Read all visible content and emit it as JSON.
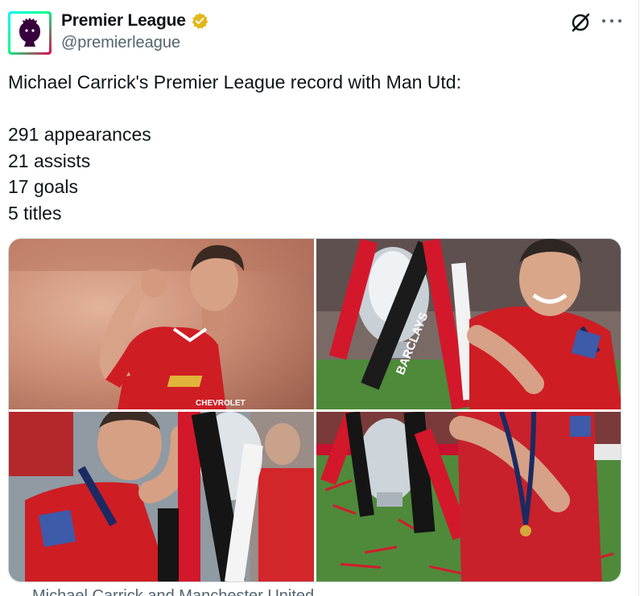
{
  "tweet": {
    "author": {
      "display_name": "Premier League",
      "handle": "@premierleague",
      "verified_badge": "gold-verified-icon"
    },
    "text_lines": [
      "Michael Carrick's Premier League record with Man Utd:",
      "",
      "291 appearances",
      "21 assists",
      "17 goals",
      "5 titles"
    ],
    "media_caption": "Michael Carrick and Manchester United"
  },
  "header_icons": [
    "grok-icon",
    "more-options-icon"
  ],
  "photo_text": {
    "shirt_sponsor": "CHEVROLET",
    "ribbon_text": "BARCLAYS"
  },
  "colors": {
    "text_primary": "#0f1419",
    "text_secondary": "#536471",
    "verified_gold": "#e2b719",
    "united_red": "#c8102e",
    "border": "#cfd9de"
  }
}
